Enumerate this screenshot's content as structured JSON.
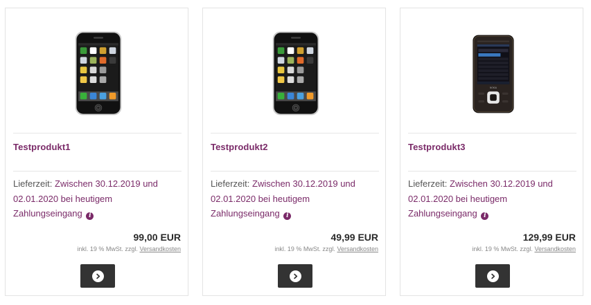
{
  "products": [
    {
      "name": "Testprodukt1",
      "image": "iphone-image",
      "delivery_label": "Lieferzeit:",
      "delivery_value_1": "Zwischen 30.12.2019 und",
      "delivery_value_2": "02.01.2020 bei heutigem",
      "delivery_value_3": "Zahlungseingang",
      "price": "99,00 EUR",
      "tax_text": "inkl. 19 % MwSt. zzgl.",
      "shipping_link": "Versandkosten"
    },
    {
      "name": "Testprodukt2",
      "image": "iphone-image",
      "delivery_label": "Lieferzeit:",
      "delivery_value_1": "Zwischen 30.12.2019 und",
      "delivery_value_2": "02.01.2020 bei heutigem",
      "delivery_value_3": "Zahlungseingang",
      "price": "49,99 EUR",
      "tax_text": "inkl. 19 % MwSt. zzgl.",
      "shipping_link": "Versandkosten"
    },
    {
      "name": "Testprodukt3",
      "image": "nokia-phone-image",
      "delivery_label": "Lieferzeit:",
      "delivery_value_1": "Zwischen 30.12.2019 und",
      "delivery_value_2": "02.01.2020 bei heutigem",
      "delivery_value_3": "Zahlungseingang",
      "price": "129,99 EUR",
      "tax_text": "inkl. 19 % MwSt. zzgl.",
      "shipping_link": "Versandkosten"
    }
  ],
  "colors": {
    "accent": "#7a2a68",
    "button": "#333333"
  },
  "icons": {
    "info": "info-icon",
    "arrow": "arrow-right-icon"
  }
}
